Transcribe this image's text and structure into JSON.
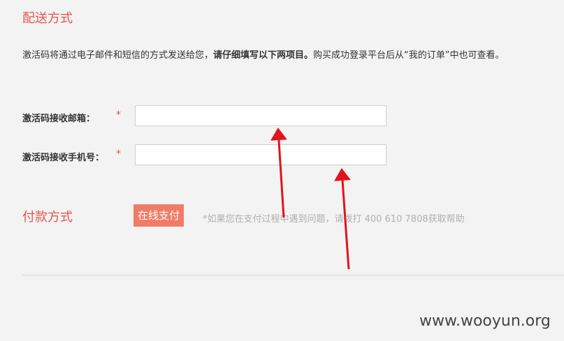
{
  "delivery": {
    "title": "配送方式",
    "description_prefix": "激活码将通过电子邮件和短信的方式发送给您，",
    "description_bold": "请仔细填写以下两项目。",
    "description_suffix": "购买成功登录平台后从“我的订单”中也可查看。"
  },
  "form": {
    "email": {
      "label": "激活码接收邮箱：",
      "required_mark": "*",
      "value": ""
    },
    "phone": {
      "label": "激活码接收手机号：",
      "required_mark": "*",
      "value": ""
    }
  },
  "payment": {
    "title": "付款方式",
    "button_label": "在线支付",
    "help_note": "*如果您在支付过程中遇到问题，请拨打 400 610 7808获取帮助"
  },
  "colors": {
    "accent": "#e2574c",
    "button": "#f07b67",
    "annotation_arrow": "#e0141b"
  },
  "watermark": "www.wooyun.org"
}
